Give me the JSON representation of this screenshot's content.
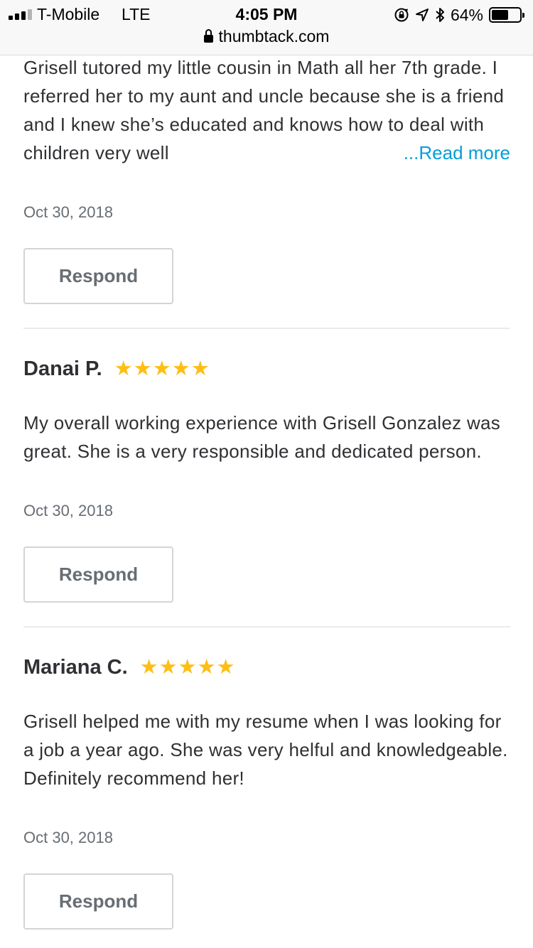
{
  "status_bar": {
    "carrier": "T-Mobile",
    "network": "LTE",
    "time": "4:05 PM",
    "battery_percent": "64%",
    "battery_level": 0.64,
    "url": "thumbtack.com"
  },
  "reviews": [
    {
      "text": "Grisell tutored my little cousin in Math all her 7th grade. I referred her to my aunt and uncle because she is a friend and I knew she’s educated and knows how to deal with children very well",
      "read_more": "...Read more",
      "date": "Oct 30, 2018",
      "respond_label": "Respond"
    },
    {
      "name": "Danai P.",
      "rating": 5,
      "stars": "★★★★★",
      "text": "My overall working experience with Grisell Gonzalez was great. She is a very responsible and dedicated person.",
      "date": "Oct 30, 2018",
      "respond_label": "Respond"
    },
    {
      "name": "Mariana C.",
      "rating": 5,
      "stars": "★★★★★",
      "text": "Grisell helped me with my resume when I was looking for a job a year ago. She was very helful and knowledgeable. Definitely recommend her!",
      "date": "Oct 30, 2018",
      "respond_label": "Respond"
    }
  ],
  "colors": {
    "star": "#febe14",
    "link": "#009fd9",
    "text": "#2f3033",
    "muted": "#676d73"
  }
}
